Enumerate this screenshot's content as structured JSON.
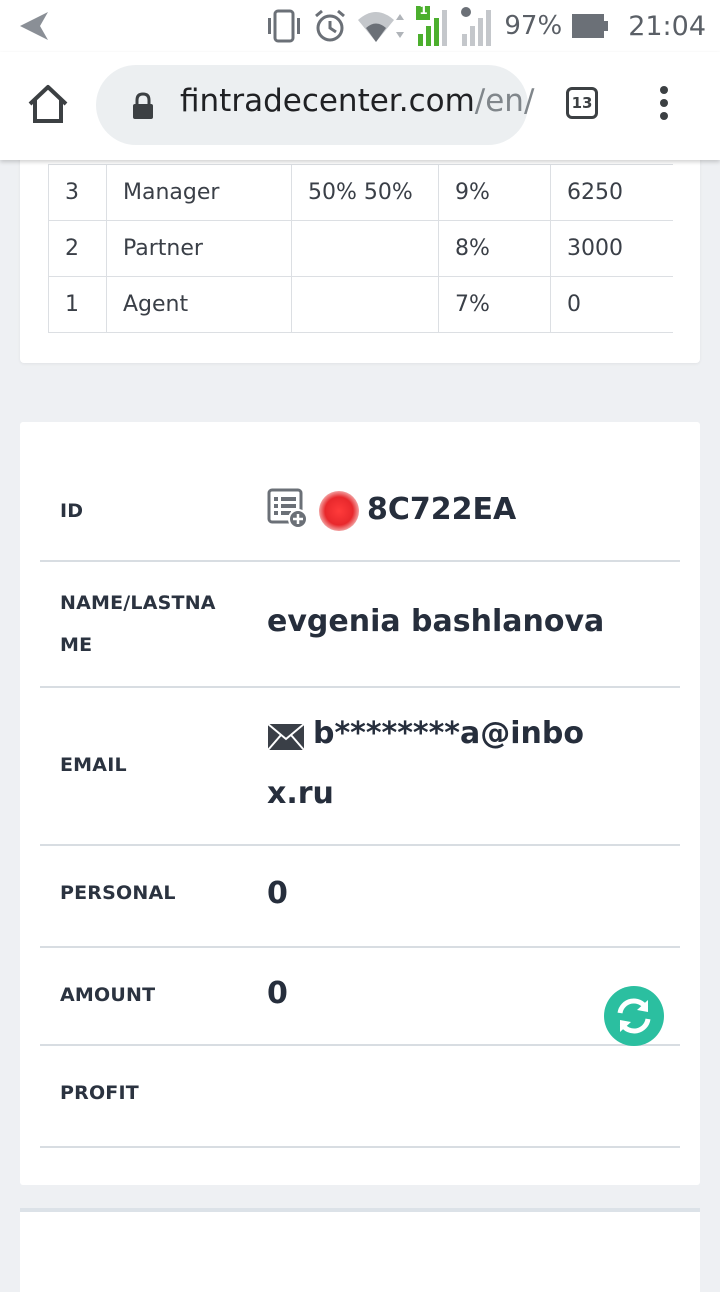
{
  "status_bar": {
    "battery": "97%",
    "time": "21:04",
    "sim_label": "1"
  },
  "browser": {
    "url_host": "fintradecenter.com",
    "url_path": "/en/",
    "tab_count": "13"
  },
  "levels_table": {
    "rows": [
      {
        "level": "3",
        "name": "Manager",
        "split": "50% 50%",
        "percent": "9%",
        "amount": "6250"
      },
      {
        "level": "2",
        "name": "Partner",
        "split": "",
        "percent": "8%",
        "amount": "3000"
      },
      {
        "level": "1",
        "name": "Agent",
        "split": "",
        "percent": "7%",
        "amount": "0"
      }
    ]
  },
  "profile": {
    "id_label": "ID",
    "id_value": "8C722EA",
    "status_color": "#e8282c",
    "name_label_line1": "NAME/LASTNA",
    "name_label_line2": "ME",
    "name_value": "evgenia bashlanova",
    "email_label": "EMAIL",
    "email_line1": "b********a@inbo",
    "email_line2": "x.ru",
    "personal_label": "PERSONAL",
    "personal_value": "0",
    "amount_label": "AMOUNT",
    "amount_value": "0",
    "profit_label": "PROFIT"
  },
  "colors": {
    "accent_teal": "#2bbfa0"
  }
}
